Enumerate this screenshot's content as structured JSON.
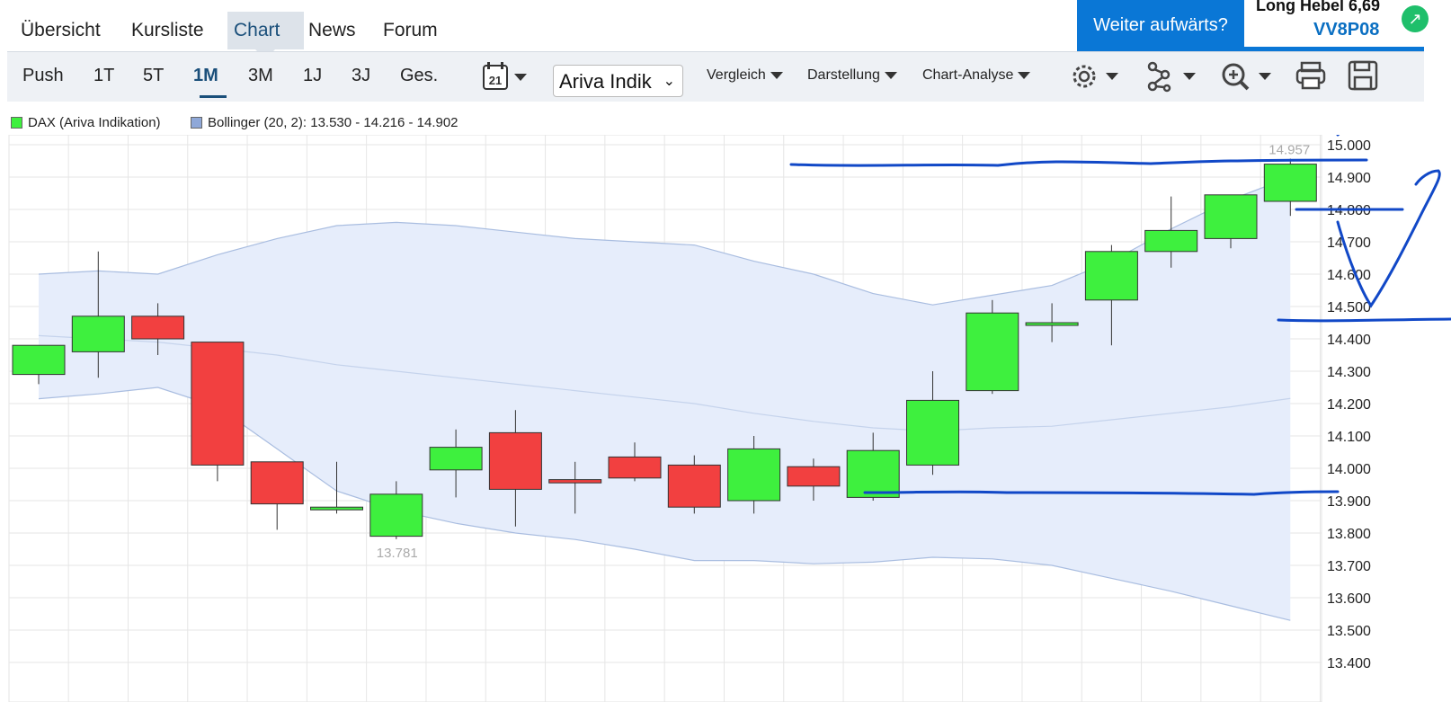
{
  "nav": {
    "tabs": [
      "Übersicht",
      "Kursliste",
      "Chart",
      "News",
      "Forum"
    ],
    "active_tab": "Chart"
  },
  "promo": {
    "button": "Weiter aufwärts?",
    "title": "Long Hebel 6,69",
    "code": "VV8P08",
    "badge_icon": "arrow-up-right-icon"
  },
  "toolbar": {
    "push": "Push",
    "ranges": [
      "1T",
      "5T",
      "1M",
      "3M",
      "1J",
      "3J",
      "Ges."
    ],
    "active_range": "1M",
    "calendar_day": "21",
    "source_select": "Ariva Indik",
    "menus": [
      "Vergleich",
      "Darstellung",
      "Chart-Analyse"
    ],
    "icons": [
      "settings-gear-icon",
      "network-nodes-icon",
      "zoom-in-icon",
      "print-icon",
      "save-disk-icon"
    ]
  },
  "legend": {
    "series1": "DAX (Ariva Indikation)",
    "series1_color": "#3ef03e",
    "series2": "Bollinger (20, 2): 13.530 - 14.216 - 14.902",
    "series2_color": "#8fa8d8"
  },
  "colors": {
    "up": "#3ef03e",
    "down": "#f24040",
    "band_fill": "#e6edfb",
    "band_line": "#a9bde0",
    "annotation": "#1148c7",
    "active_tab_bg": "#dde3ea",
    "promo_blue": "#0a77d6"
  },
  "chart_data": {
    "type": "candlestick",
    "y_ticks": [
      "15.000",
      "14.900",
      "14.800",
      "14.700",
      "14.600",
      "14.500",
      "14.400",
      "14.300",
      "14.200",
      "14.100",
      "14.000",
      "13.900",
      "13.800",
      "13.700",
      "13.600",
      "13.500",
      "13.400"
    ],
    "ylim": [
      13360,
      15030
    ],
    "high_label": "14.957",
    "low_label": "13.781",
    "candles": [
      {
        "o": 14290,
        "h": 14340,
        "l": 14260,
        "c": 14380
      },
      {
        "o": 14360,
        "h": 14670,
        "l": 14280,
        "c": 14470
      },
      {
        "o": 14470,
        "h": 14510,
        "l": 14350,
        "c": 14400
      },
      {
        "o": 14390,
        "h": 14390,
        "l": 13960,
        "c": 14010
      },
      {
        "o": 14020,
        "h": 14020,
        "l": 13810,
        "c": 13890
      },
      {
        "o": 13880,
        "h": 14020,
        "l": 13860,
        "c": 13880
      },
      {
        "o": 13790,
        "h": 13960,
        "l": 13781,
        "c": 13920
      },
      {
        "o": 13995,
        "h": 14120,
        "l": 13910,
        "c": 14065
      },
      {
        "o": 14110,
        "h": 14180,
        "l": 13820,
        "c": 13935
      },
      {
        "o": 13965,
        "h": 14020,
        "l": 13860,
        "c": 13955
      },
      {
        "o": 14035,
        "h": 14080,
        "l": 13960,
        "c": 13970
      },
      {
        "o": 14010,
        "h": 14040,
        "l": 13860,
        "c": 13880
      },
      {
        "o": 13900,
        "h": 14100,
        "l": 13860,
        "c": 14060
      },
      {
        "o": 14005,
        "h": 14030,
        "l": 13900,
        "c": 13945
      },
      {
        "o": 13910,
        "h": 14110,
        "l": 13900,
        "c": 14055
      },
      {
        "o": 14010,
        "h": 14300,
        "l": 13980,
        "c": 14210
      },
      {
        "o": 14240,
        "h": 14520,
        "l": 14230,
        "c": 14480
      },
      {
        "o": 14450,
        "h": 14510,
        "l": 14390,
        "c": 14450
      },
      {
        "o": 14520,
        "h": 14690,
        "l": 14380,
        "c": 14670
      },
      {
        "o": 14670,
        "h": 14840,
        "l": 14620,
        "c": 14735
      },
      {
        "o": 14710,
        "h": 14840,
        "l": 14680,
        "c": 14845
      },
      {
        "o": 14825,
        "h": 14957,
        "l": 14780,
        "c": 14940
      }
    ],
    "bollinger": {
      "upper": [
        14600,
        14610,
        14600,
        14660,
        14710,
        14750,
        14760,
        14750,
        14730,
        14710,
        14700,
        14690,
        14640,
        14600,
        14540,
        14505,
        14535,
        14565,
        14640,
        14740,
        14830,
        14900
      ],
      "middle": [
        14410,
        14400,
        14390,
        14370,
        14350,
        14320,
        14300,
        14280,
        14260,
        14240,
        14220,
        14200,
        14170,
        14145,
        14125,
        14115,
        14125,
        14130,
        14150,
        14170,
        14190,
        14216
      ],
      "lower": [
        14215,
        14230,
        14250,
        14190,
        14060,
        13930,
        13870,
        13830,
        13800,
        13780,
        13750,
        13715,
        13715,
        13705,
        13710,
        13725,
        13720,
        13700,
        13660,
        13620,
        13575,
        13530
      ]
    },
    "grid": true,
    "legend": "top-left"
  }
}
